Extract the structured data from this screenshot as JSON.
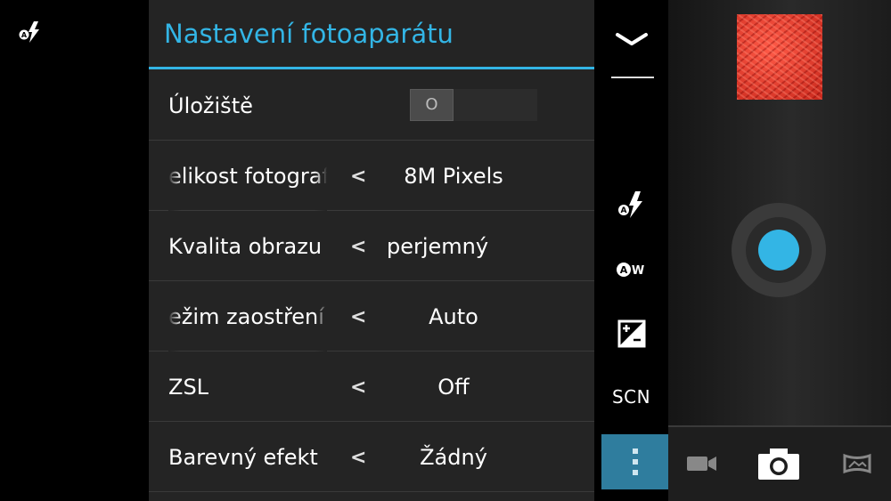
{
  "panel": {
    "title": "Nastavení fotoaparátu",
    "rows": [
      {
        "label": "Úložiště",
        "toggle_value": "O"
      },
      {
        "label": "elikost fotograf",
        "value": "8M Pixels"
      },
      {
        "label": "Kvalita obrazu",
        "value": "perjemný"
      },
      {
        "label": "ežim zaostření",
        "value": "Auto"
      },
      {
        "label": "ZSL",
        "value": "Off"
      },
      {
        "label": "Barevný efekt",
        "value": "Žádný"
      }
    ],
    "arrow_glyph": "<"
  },
  "strip": {
    "scene_label": "SCN",
    "icons": [
      "chevron-down-icon",
      "flash-auto-icon",
      "white-balance-auto-icon",
      "exposure-icon",
      "more-vert-icon"
    ]
  },
  "modes": {
    "icons": [
      "video-camera-icon",
      "photo-camera-icon",
      "panorama-icon"
    ],
    "active": "photo-camera-icon"
  },
  "colors": {
    "accent": "#33b5e5",
    "panel_bg": "#242424",
    "active_control_bg": "#2f7d9e",
    "thumbnail": "#e0392b"
  }
}
